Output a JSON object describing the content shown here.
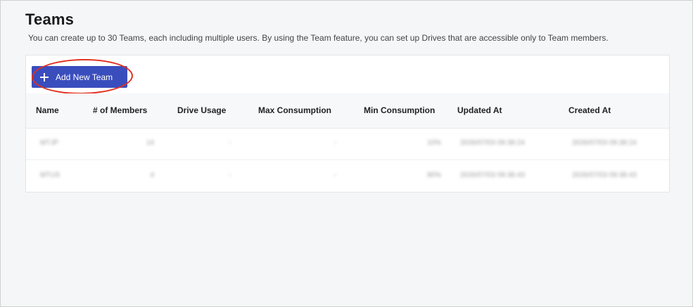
{
  "page": {
    "title": "Teams",
    "subtitle": "You can create up to 30 Teams, each including multiple users. By using the Team feature, you can set up Drives that are accessible only to Team members."
  },
  "toolbar": {
    "add_button_label": "Add New Team",
    "add_button_icon": "plus-icon",
    "highlight_color": "#e0311f",
    "button_color": "#3a4dbd"
  },
  "table": {
    "columns": [
      "Name",
      "# of Members",
      "Drive Usage",
      "Max Consumption",
      "Min Consumption",
      "Updated At",
      "Created At"
    ],
    "rows": [
      [
        "MTJP",
        "14",
        "-",
        "-",
        "10%",
        "2026/07/03 09:38:24",
        "2026/07/03 09:38:24"
      ],
      [
        "MTUS",
        "4",
        "-",
        "-",
        "90%",
        "2026/07/03 09:38:43",
        "2026/07/03 09:38:43"
      ]
    ]
  }
}
